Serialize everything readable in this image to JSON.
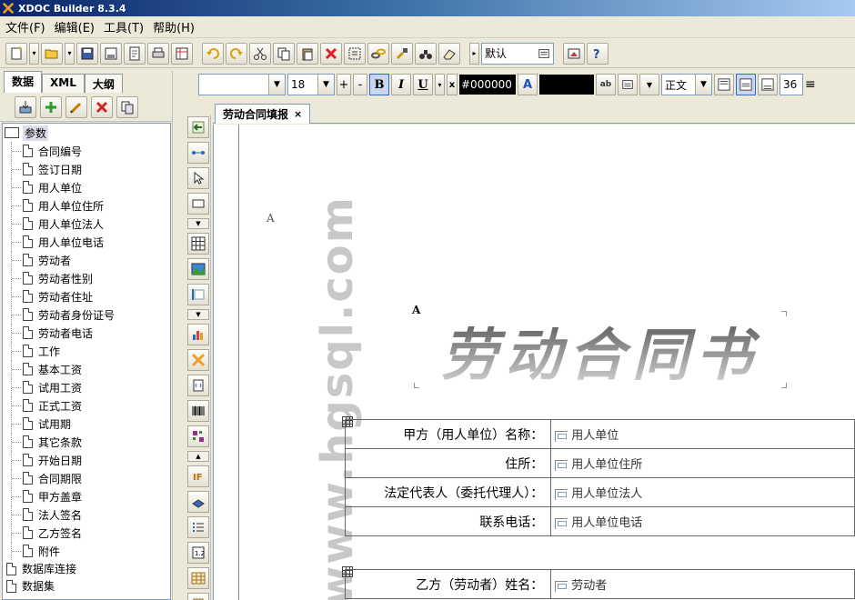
{
  "app": {
    "title": "XDOC Builder 8.3.4",
    "logo_icon": "xdoc-logo-icon"
  },
  "menu": [
    {
      "label": "文件(F)"
    },
    {
      "label": "编辑(E)"
    },
    {
      "label": "工具(T)"
    },
    {
      "label": "帮助(H)"
    }
  ],
  "toolbar": {
    "style_select": "默认"
  },
  "left_panel": {
    "tabs": [
      "数据",
      "XML",
      "大纲"
    ],
    "tree_root": "参数",
    "params": [
      "合同编号",
      "签订日期",
      "用人单位",
      "用人单位住所",
      "用人单位法人",
      "用人单位电话",
      "劳动者",
      "劳动者性别",
      "劳动者住址",
      "劳动者身份证号",
      "劳动者电话",
      "工作",
      "基本工资",
      "试用工资",
      "正式工资",
      "试用期",
      "其它条款",
      "开始日期",
      "合同期限",
      "甲方盖章",
      "法人签名",
      "乙方签名",
      "附件"
    ],
    "other_nodes": [
      "数据库连接",
      "数据集"
    ]
  },
  "format_bar": {
    "font_name": "",
    "font_size": "18",
    "bold": "B",
    "italic": "I",
    "underline": "U",
    "color_hex": "#000000",
    "paragraph_style": "正文",
    "line_spacing": "36"
  },
  "document": {
    "tab_label": "劳动合同填报",
    "close_label": "×",
    "watermark": "www.hgsql.com",
    "anchor_a": "A",
    "title": "劳动合同书",
    "party_a_rows": [
      {
        "label": "甲方（用人单位）名称：",
        "value": "用人单位"
      },
      {
        "label": "住所：",
        "value": "用人单位住所"
      },
      {
        "label": "法定代表人（委托代理人）：",
        "value": "用人单位法人"
      },
      {
        "label": "联系电话：",
        "value": "用人单位电话"
      }
    ],
    "party_b_rows": [
      {
        "label": "乙方（劳动者）姓名：",
        "value": "劳动者"
      }
    ]
  }
}
